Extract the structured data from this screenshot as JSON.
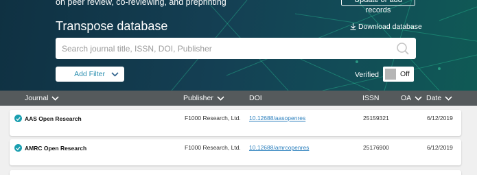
{
  "hero": {
    "tagline": "on peer review, co-reviewing, and preprinting",
    "update_button": "Update or add records",
    "title": "Transpose database",
    "download_label": "Download database"
  },
  "search": {
    "placeholder": "Search journal title, ISSN, DOI, Publisher"
  },
  "filter": {
    "add_label": "Add Filter"
  },
  "verified": {
    "label": "Verified",
    "state": "Off"
  },
  "table": {
    "headers": {
      "journal": "Journal",
      "publisher": "Publisher",
      "doi": "DOI",
      "issn": "ISSN",
      "oa": "OA",
      "date": "Date"
    },
    "rows": [
      {
        "journal": "AAS Open Research",
        "publisher": "F1000 Research, Ltd.",
        "doi": "10.12688/aasopenres",
        "issn": "25159321",
        "date": "6/12/2019",
        "verified": true
      },
      {
        "journal": "AMRC Open Research",
        "publisher": "F1000 Research, Ltd.",
        "doi": "10.12688/amrcopenres",
        "issn": "25176900",
        "date": "6/12/2019",
        "verified": true
      }
    ]
  },
  "colors": {
    "accent": "#2b8fb0",
    "header_bar": "#555a5c",
    "check": "#1a9fb0"
  }
}
